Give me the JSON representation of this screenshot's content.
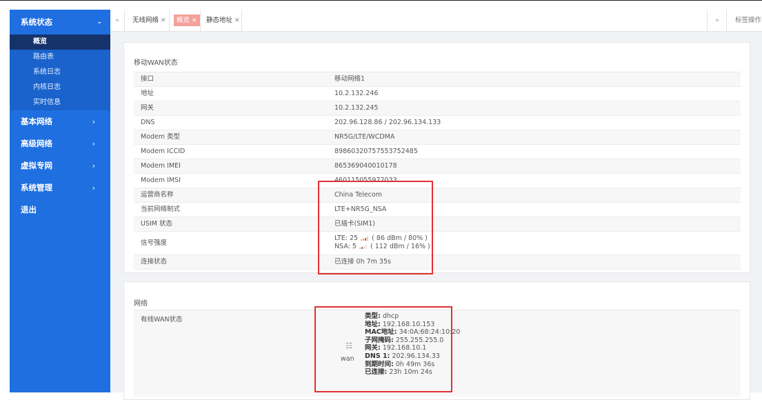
{
  "sidebar": {
    "header": {
      "label": "系统状态",
      "chevron": "⌄"
    },
    "subitems": [
      {
        "label": "概览"
      },
      {
        "label": "路由表"
      },
      {
        "label": "系统日志"
      },
      {
        "label": "内核日志"
      },
      {
        "label": "实时信息"
      }
    ],
    "items": [
      {
        "label": "基本网络",
        "arrow": "›"
      },
      {
        "label": "高级网络",
        "arrow": "›"
      },
      {
        "label": "虚拟专网",
        "arrow": "›"
      },
      {
        "label": "系统管理",
        "arrow": "›"
      },
      {
        "label": "退出",
        "arrow": ""
      }
    ]
  },
  "tabbar": {
    "left_icon": "«",
    "tabs": [
      {
        "label": "无线网络",
        "close": "✕"
      },
      {
        "label": "概览",
        "close": "✕"
      },
      {
        "label": "静态地址",
        "close": "✕"
      }
    ],
    "right_icon": "»",
    "ops_label": "标签操作"
  },
  "mobile_wan": {
    "title": "移动WAN状态",
    "rows": [
      {
        "key": "接口",
        "value": "移动网络1"
      },
      {
        "key": "地址",
        "value": "10.2.132.246"
      },
      {
        "key": "网关",
        "value": "10.2.132.245"
      },
      {
        "key": "DNS",
        "value": "202.96.128.86 / 202.96.134.133"
      },
      {
        "key": "Modem 类型",
        "value": "NR5G/LTE/WCDMA"
      },
      {
        "key": "Modem ICCID",
        "value": "89860320757553752485"
      },
      {
        "key": "Modem IMEI",
        "value": "865369040010178"
      },
      {
        "key": "Modem IMSI",
        "value": "460115055972033"
      },
      {
        "key": "运营商名称",
        "value": "China Telecom"
      },
      {
        "key": "当前网络制式",
        "value": "LTE+NR5G_NSA"
      },
      {
        "key": "USIM 状态",
        "value": "已插卡(SIM1)"
      }
    ],
    "signal": {
      "key": "信号强度",
      "lte_label": "LTE: 25",
      "lte_detail": "( 86 dBm / 80% )",
      "lte_level": 0.8,
      "nsa_label": "NSA: 5",
      "nsa_detail": "( 112 dBm / 16% )",
      "nsa_level": 0.16
    },
    "conn": {
      "key": "连接状态",
      "value": "已连接 0h 7m 35s"
    }
  },
  "network": {
    "title": "网络",
    "wan_key": "有线WAN状态",
    "wan_label": "wan",
    "info": [
      {
        "k": "类型:",
        "v": "dhcp"
      },
      {
        "k": "地址:",
        "v": "192.168.10.153"
      },
      {
        "k": "MAC地址:",
        "v": "34:0A:68:24:10:20"
      },
      {
        "k": "子网掩码:",
        "v": "255.255.255.0"
      },
      {
        "k": "网关:",
        "v": "192.168.10.1"
      },
      {
        "k": "DNS 1:",
        "v": "202.96.134.33"
      },
      {
        "k": "到期时间:",
        "v": "0h 49m 36s"
      },
      {
        "k": "已连接:",
        "v": "23h 10m 24s"
      }
    ]
  },
  "colors": {
    "sidebar": "#1f6fe0",
    "active_sub": "#15336b",
    "active_tab": "#f5a09a",
    "highlight": "#e03030"
  }
}
